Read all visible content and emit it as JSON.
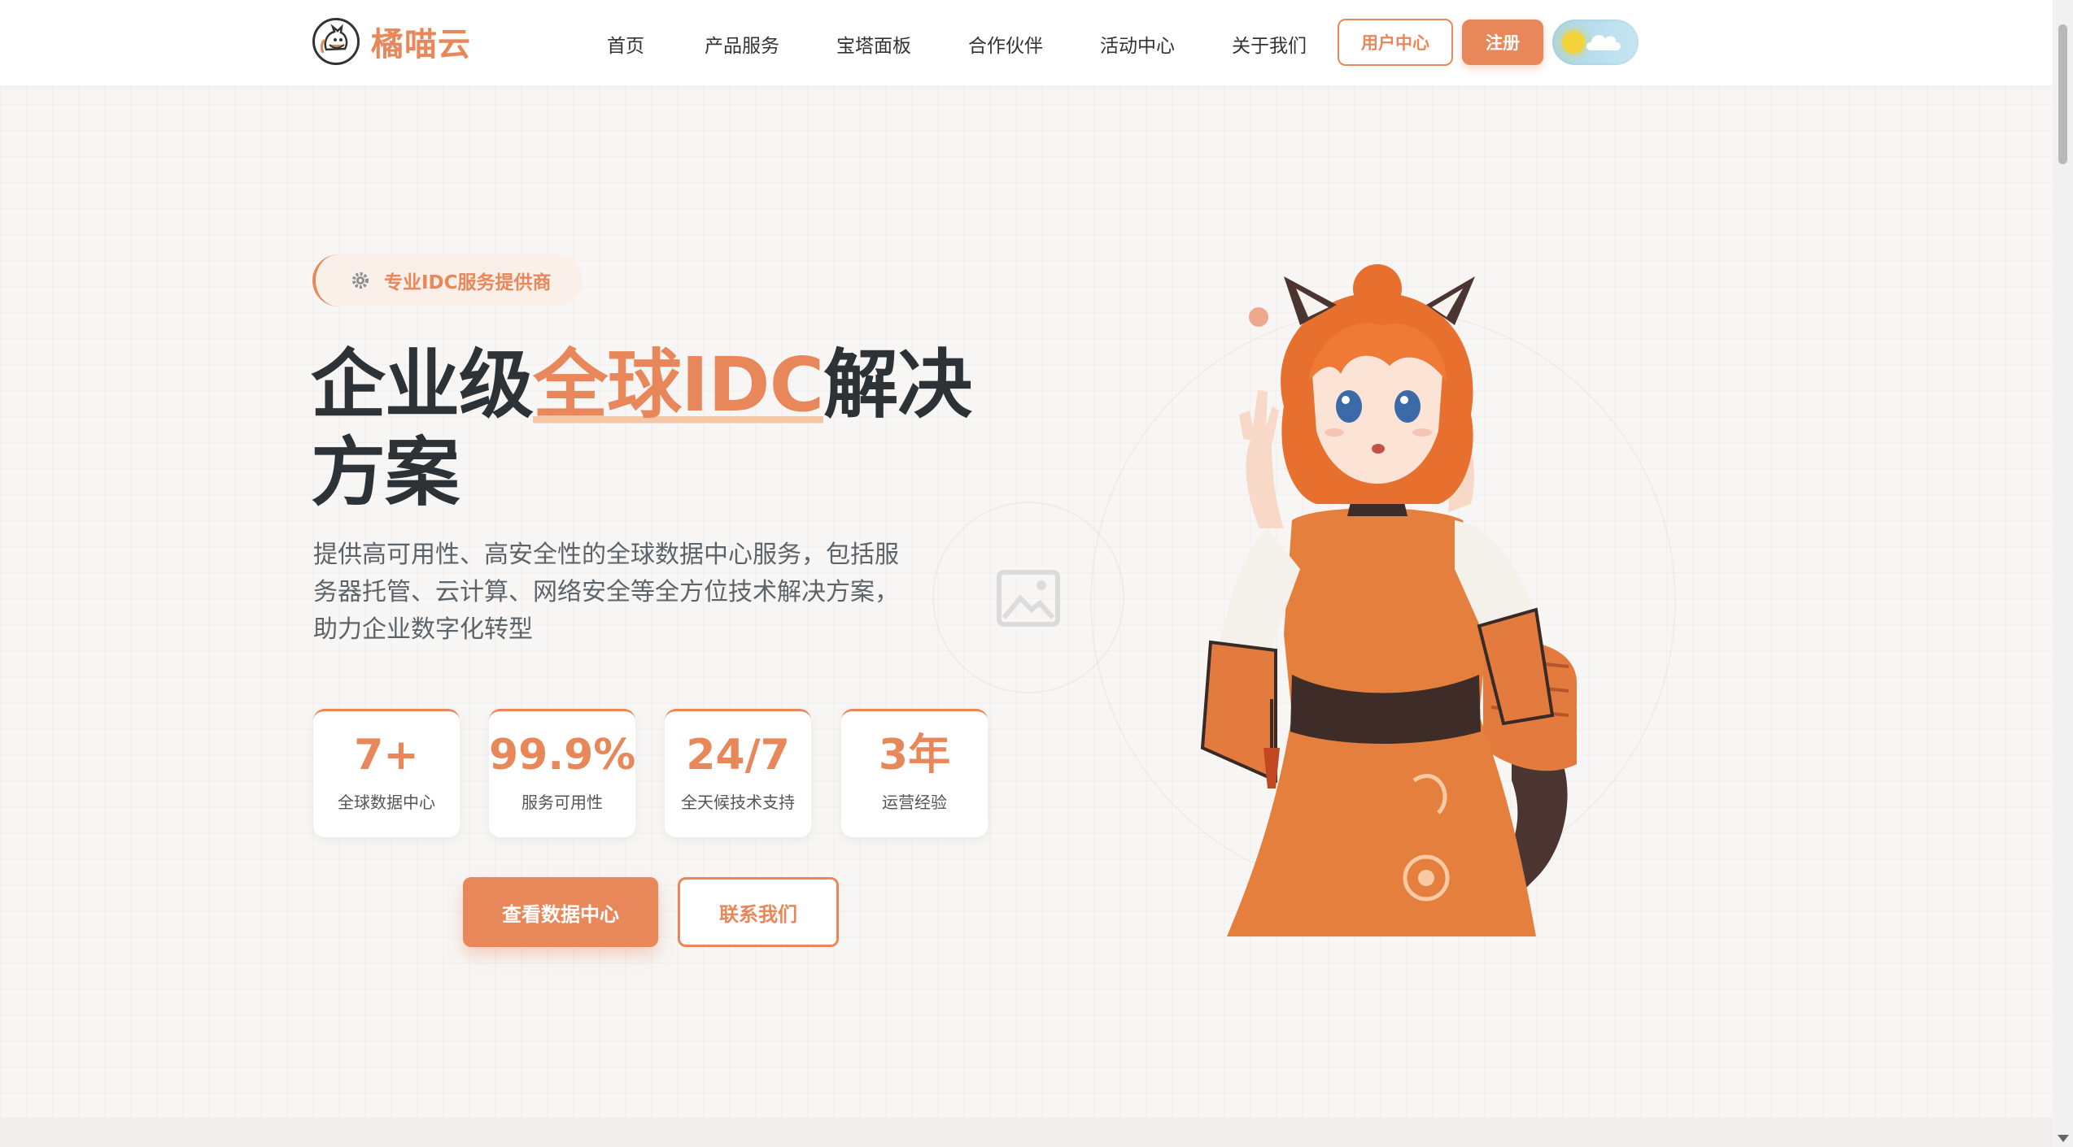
{
  "brand": {
    "name": "橘喵云",
    "accent_color": "#e8875a"
  },
  "nav": {
    "items": [
      "首页",
      "产品服务",
      "宝塔面板",
      "合作伙伴",
      "活动中心",
      "关于我们"
    ],
    "user_center": "用户中心",
    "register": "注册"
  },
  "hero": {
    "badge": "专业IDC服务提供商",
    "title_before": "企业级",
    "title_accent": "全球IDC",
    "title_after": "解决方案",
    "description": "提供高可用性、高安全性的全球数据中心服务，包括服务器托管、云计算、网络安全等全方位技术解决方案，助力企业数字化转型",
    "stats": [
      {
        "value": "7+",
        "label": "全球数据中心"
      },
      {
        "value": "99.9%",
        "label": "服务可用性"
      },
      {
        "value": "24/7",
        "label": "全天候技术支持"
      },
      {
        "value": "3年",
        "label": "运营经验"
      }
    ],
    "primary_button": "查看数据中心",
    "secondary_button": "联系我们"
  },
  "icons": {
    "logo": "cat-logo-icon",
    "theme": "sun-cloud-icon",
    "badge": "gear-icon",
    "placeholder": "image-placeholder-icon"
  }
}
